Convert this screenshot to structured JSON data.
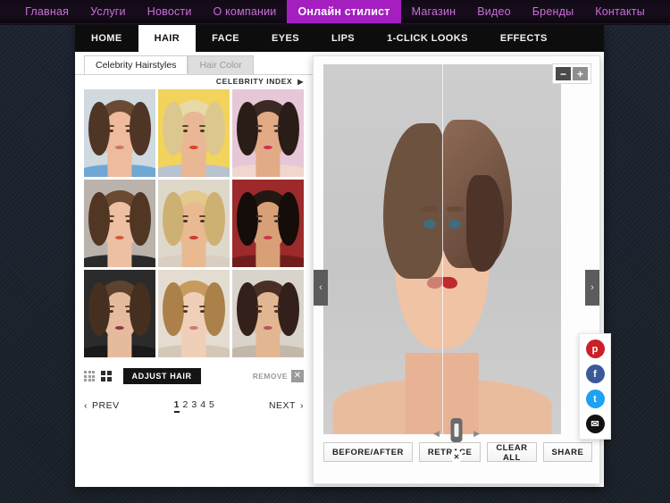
{
  "topnav": {
    "items": [
      {
        "label": "Главная",
        "active": false
      },
      {
        "label": "Услуги",
        "active": false
      },
      {
        "label": "Новости",
        "active": false
      },
      {
        "label": "О компании",
        "active": false
      },
      {
        "label": "Онлайн стилист",
        "active": true
      },
      {
        "label": "Магазин",
        "active": false
      },
      {
        "label": "Видео",
        "active": false
      },
      {
        "label": "Бренды",
        "active": false
      },
      {
        "label": "Контакты",
        "active": false
      }
    ],
    "accent_color": "#a41ec0",
    "link_color": "#c76fd6"
  },
  "app": {
    "tabs": [
      {
        "label": "HOME",
        "active": false
      },
      {
        "label": "HAIR",
        "active": true
      },
      {
        "label": "FACE",
        "active": false
      },
      {
        "label": "EYES",
        "active": false
      },
      {
        "label": "LIPS",
        "active": false
      },
      {
        "label": "1-CLICK LOOKS",
        "active": false
      },
      {
        "label": "EFFECTS",
        "active": false
      }
    ],
    "subtabs": [
      {
        "label": "Celebrity Hairstyles",
        "active": true
      },
      {
        "label": "Hair Color",
        "active": false
      }
    ],
    "celebrity_index": {
      "label": "CELEBRITY INDEX",
      "arrow": "▶"
    },
    "thumbnails": [
      {
        "name": "celebrity-1",
        "selected": true
      },
      {
        "name": "celebrity-2",
        "selected": false
      },
      {
        "name": "celebrity-3",
        "selected": false
      },
      {
        "name": "celebrity-4",
        "selected": false
      },
      {
        "name": "celebrity-5",
        "selected": false
      },
      {
        "name": "celebrity-6",
        "selected": false
      },
      {
        "name": "celebrity-7",
        "selected": false
      },
      {
        "name": "celebrity-8",
        "selected": false
      },
      {
        "name": "celebrity-9",
        "selected": false
      }
    ],
    "tools": {
      "adjust_hair_label": "ADJUST HAIR",
      "remove_label": "REMOVE",
      "remove_x": "✕"
    },
    "pager": {
      "prev_label": "PREV",
      "prev_arrow": "‹",
      "next_label": "NEXT",
      "next_arrow": "›",
      "pages": [
        "1",
        "2",
        "3",
        "4",
        "5"
      ],
      "current_page": "1"
    },
    "preview": {
      "zoom_minus": "−",
      "zoom_plus": "+",
      "nav_prev": "‹",
      "nav_next": "›",
      "slider_left_arrow": "◀",
      "slider_right_arrow": "▶",
      "slider_close": "✕"
    },
    "social": [
      {
        "name": "pinterest",
        "glyph": "p",
        "color": "#cb2027"
      },
      {
        "name": "facebook",
        "glyph": "f",
        "color": "#3b5998"
      },
      {
        "name": "twitter",
        "glyph": "t",
        "color": "#1da1f2"
      },
      {
        "name": "email",
        "glyph": "✉",
        "color": "#111111"
      }
    ],
    "actions": [
      {
        "label": "BEFORE/AFTER"
      },
      {
        "label": "RETRACE"
      },
      {
        "label": "CLEAR ALL"
      },
      {
        "label": "SHARE"
      }
    ]
  }
}
